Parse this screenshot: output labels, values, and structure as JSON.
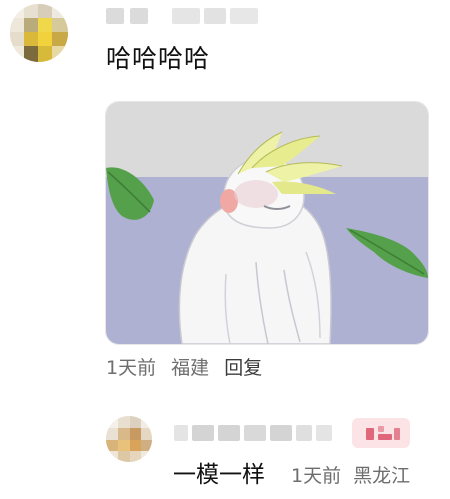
{
  "comment": {
    "text": "哈哈哈哈",
    "time": "1天前",
    "location": "福建",
    "reply_label": "回复"
  },
  "reply": {
    "text": "一模一样",
    "time": "1天前",
    "location": "黑龙江"
  },
  "icons": {
    "main_avatar": "bird-avatar-icon",
    "reply_avatar": "food-avatar-icon",
    "sticker": "cockatiel-sticker-image"
  },
  "colors": {
    "meta_text": "#6e6e6e",
    "body_text": "#111111",
    "badge_bg": "#fbe3e6"
  }
}
